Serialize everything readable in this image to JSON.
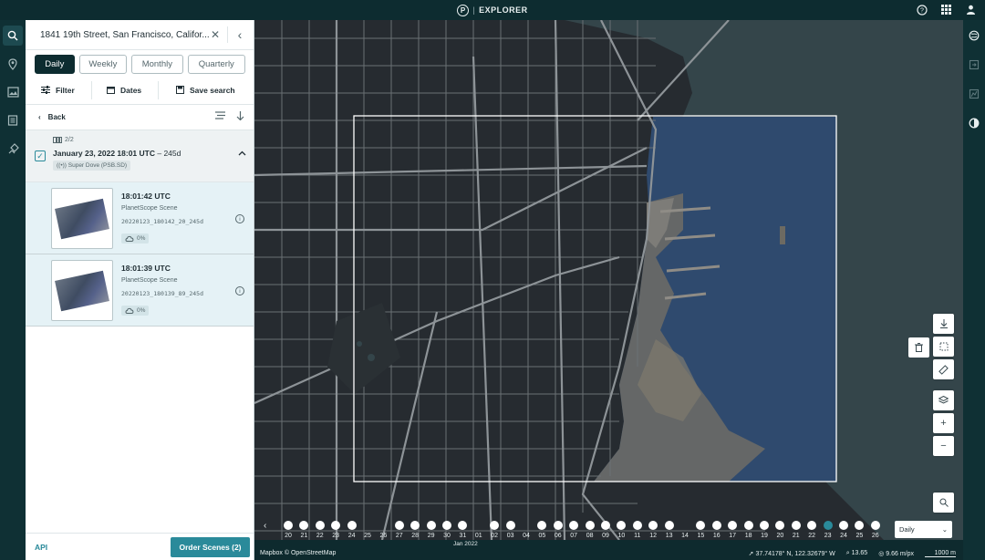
{
  "app": {
    "title": "EXPLORER"
  },
  "topbar": {
    "icons": [
      "help-icon",
      "apps-grid-icon",
      "account-icon"
    ]
  },
  "left_rail": {
    "icons": [
      "search-icon",
      "places-icon",
      "image-library-icon",
      "orders-icon",
      "tasking-icon"
    ]
  },
  "right_rail": {
    "icons": [
      "basemap-icon",
      "export-icon",
      "analysis-icon",
      "time-lapse-icon"
    ]
  },
  "search": {
    "value": "1841 19th Street, San Francisco, Califor..."
  },
  "periods": [
    {
      "label": "Daily",
      "active": true
    },
    {
      "label": "Weekly",
      "active": false
    },
    {
      "label": "Monthly",
      "active": false
    },
    {
      "label": "Quarterly",
      "active": false
    }
  ],
  "toolbar": {
    "filter": "Filter",
    "dates": "Dates",
    "save_search": "Save search"
  },
  "results": {
    "back_label": "Back",
    "group": {
      "count": "2/2",
      "date": "January 23, 2022 18:01 UTC",
      "age": "– 245d",
      "sensor": "Super Dove (PSB.SD)"
    },
    "scenes": [
      {
        "time": "18:01:42 UTC",
        "type": "PlanetScope Scene",
        "id": "20220123_180142_20_245d",
        "cloud": "0%"
      },
      {
        "time": "18:01:39 UTC",
        "type": "PlanetScope Scene",
        "id": "20220123_180139_89_245d",
        "cloud": "0%"
      }
    ]
  },
  "footer": {
    "api_label": "API",
    "order_label": "Order Scenes (2)"
  },
  "timeline": {
    "days": [
      "20",
      "21",
      "22",
      "23",
      "24",
      "25",
      "26",
      "27",
      "28",
      "29",
      "30",
      "31",
      "01",
      "02",
      "03",
      "04",
      "05",
      "06",
      "07",
      "08",
      "09",
      "10",
      "11",
      "12",
      "13",
      "14",
      "15",
      "16",
      "17",
      "18",
      "19",
      "20",
      "21",
      "22",
      "23",
      "24",
      "25",
      "26"
    ],
    "dots": [
      1,
      1,
      1,
      1,
      1,
      0,
      0,
      1,
      1,
      1,
      1,
      1,
      0,
      1,
      1,
      0,
      1,
      1,
      1,
      1,
      1,
      1,
      1,
      1,
      1,
      0,
      1,
      1,
      1,
      1,
      1,
      1,
      1,
      1,
      2,
      1,
      1,
      1
    ],
    "month_label": "Jan 2022",
    "select_value": "Daily"
  },
  "status": {
    "attribution": "Mapbox © OpenStreetMap",
    "coords": "37.74178° N, 122.32679° W",
    "zoom": "13.65",
    "resolution": "9.66 m/px",
    "scale": "1000 m"
  },
  "colors": {
    "accent": "#2a8a9a",
    "chrome": "#0d2c30",
    "map_land": "#262b30",
    "water": "#34454a"
  }
}
